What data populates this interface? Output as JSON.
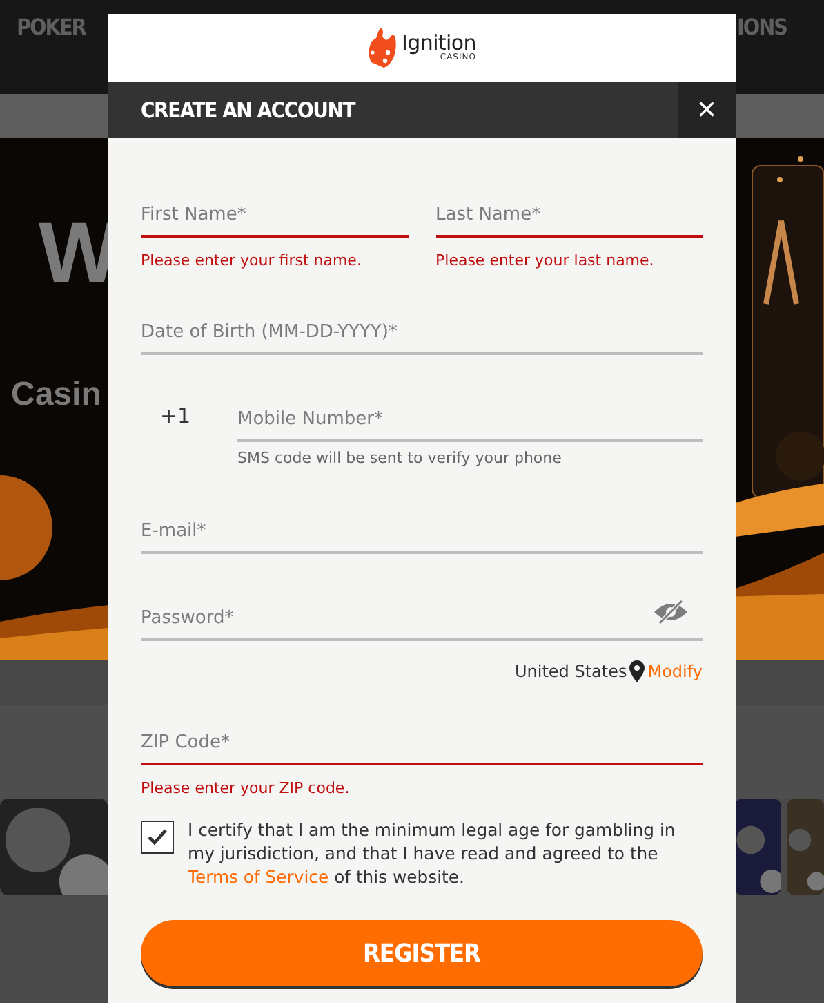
{
  "background": {
    "nav_items": [
      "POKER",
      "IONS"
    ],
    "hero_texts": [
      "W",
      "Casin"
    ]
  },
  "modal": {
    "logo": {
      "name": "Ignition",
      "subtitle": "CASINO"
    },
    "title": "CREATE AN ACCOUNT",
    "close": "×",
    "name_fields": [
      {
        "placeholder": "First Name*",
        "invalid": true,
        "error": "Please enter your first name."
      },
      {
        "placeholder": "Last Name*",
        "invalid": true,
        "error": "Please enter your last name."
      }
    ],
    "dob_field": {
      "placeholder": "Date of Birth (MM-DD-YYYY)*",
      "invalid": false
    },
    "phone": {
      "prefix": "+1",
      "placeholder": "Mobile Number*",
      "invalid": false,
      "hint": "SMS code will be sent to verify your phone"
    },
    "email_field": {
      "placeholder": "E-mail*",
      "invalid": false
    },
    "password_field": {
      "placeholder": "Password*",
      "invalid": false
    },
    "location": {
      "country": "United States",
      "link": "Modify"
    },
    "zip_field": {
      "placeholder": "ZIP Code*",
      "invalid": true,
      "error": "Please enter your ZIP code."
    },
    "consent": {
      "checked": true,
      "text_before": "I certify that I am the minimum legal age for gambling in my jurisdiction, and that I have read and agreed to the",
      "link": "Terms of Service",
      "text_after": "of this website."
    },
    "register_button": "REGISTER"
  }
}
